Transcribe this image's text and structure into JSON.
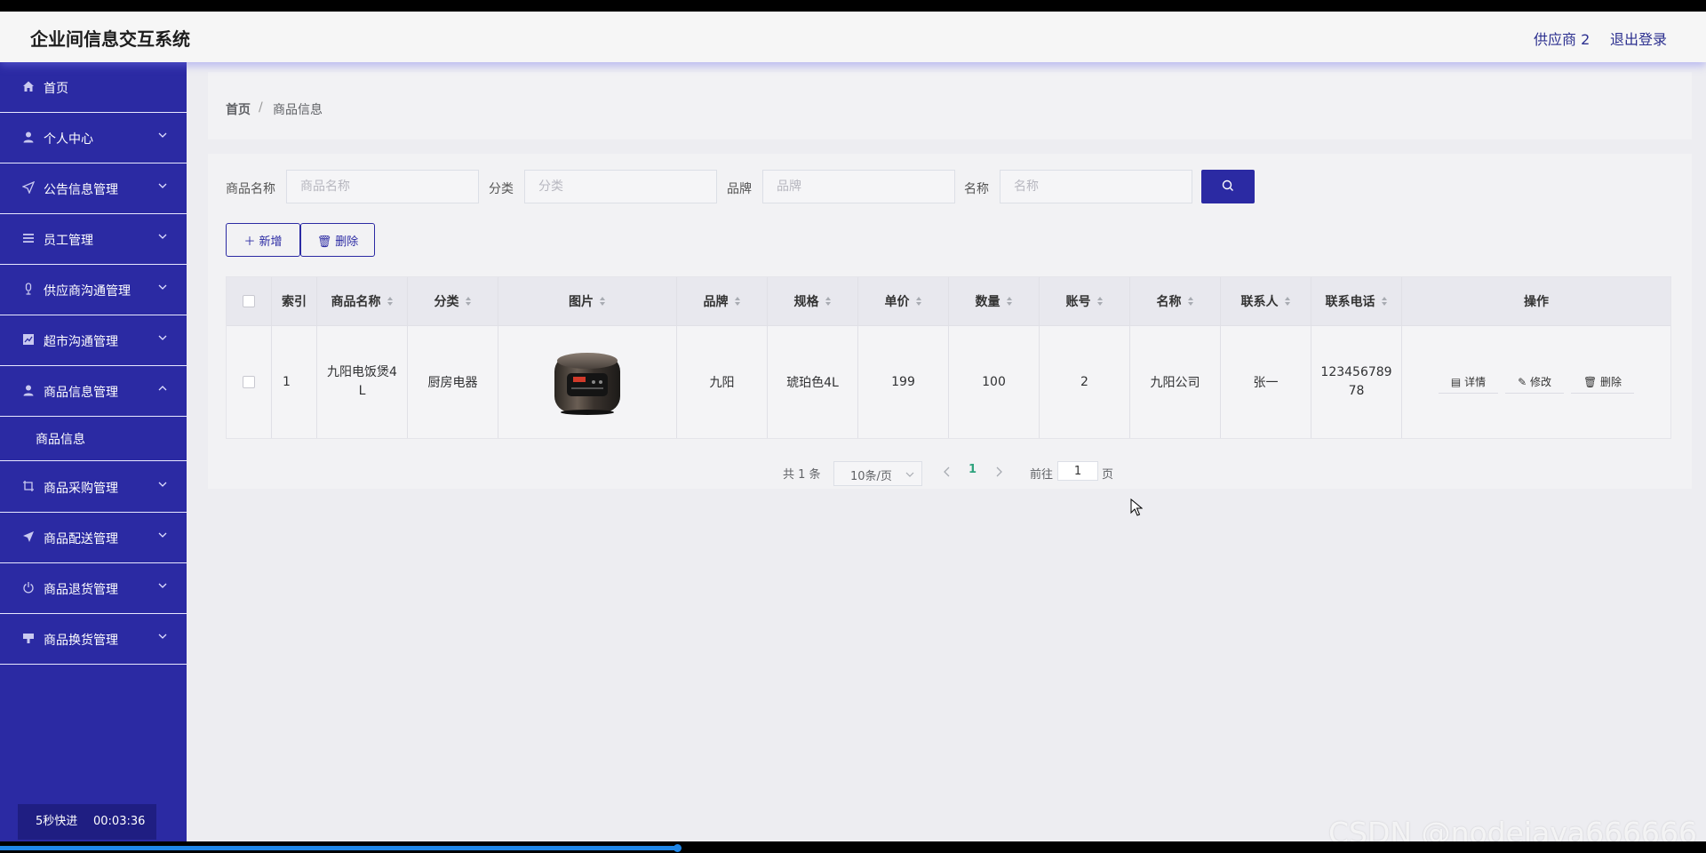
{
  "header": {
    "title": "企业间信息交互系统",
    "user": "供应商 2",
    "logout": "退出登录"
  },
  "sidebar": {
    "items": [
      {
        "label": "首页",
        "icon": "home-icon",
        "has_arrow": false
      },
      {
        "label": "个人中心",
        "icon": "user-icon",
        "has_arrow": true
      },
      {
        "label": "公告信息管理",
        "icon": "send-icon",
        "has_arrow": true
      },
      {
        "label": "员工管理",
        "icon": "menu-lines-icon",
        "has_arrow": true
      },
      {
        "label": "供应商沟通管理",
        "icon": "microphone-icon",
        "has_arrow": true
      },
      {
        "label": "超市沟通管理",
        "icon": "chart-icon",
        "has_arrow": true
      },
      {
        "label": "商品信息管理",
        "icon": "user-icon",
        "has_arrow": true,
        "expanded": true
      },
      {
        "label": "商品采购管理",
        "icon": "crop-icon",
        "has_arrow": true
      },
      {
        "label": "商品配送管理",
        "icon": "send-icon",
        "has_arrow": true
      },
      {
        "label": "商品退货管理",
        "icon": "power-icon",
        "has_arrow": true
      },
      {
        "label": "商品换货管理",
        "icon": "stamp-icon",
        "has_arrow": true
      }
    ],
    "sub_item": "商品信息",
    "timer": {
      "speed": "5秒快进",
      "time": "00:03:36"
    }
  },
  "breadcrumb": {
    "home": "首页",
    "separator": "/",
    "current": "商品信息"
  },
  "filters": [
    {
      "label": "商品名称",
      "placeholder": "商品名称"
    },
    {
      "label": "分类",
      "placeholder": "分类"
    },
    {
      "label": "品牌",
      "placeholder": "品牌"
    },
    {
      "label": "名称",
      "placeholder": "名称"
    }
  ],
  "actions": {
    "add": "新增",
    "delete": "删除"
  },
  "table": {
    "headers": [
      "索引",
      "商品名称",
      "分类",
      "图片",
      "品牌",
      "规格",
      "单价",
      "数量",
      "账号",
      "名称",
      "联系人",
      "联系电话",
      "操作"
    ],
    "row": {
      "index": "1",
      "product_name": "九阳电饭煲4L",
      "category": "厨房电器",
      "brand": "九阳",
      "spec": "琥珀色4L",
      "price": "199",
      "quantity": "100",
      "account": "2",
      "company": "九阳公司",
      "contact": "张一",
      "phone": "12345678978"
    },
    "row_actions": {
      "detail": "详情",
      "edit": "修改",
      "delete": "删除"
    }
  },
  "pagination": {
    "total": "共 1 条",
    "page_size": "10条/页",
    "current": "1",
    "goto_prefix": "前往",
    "goto_value": "1",
    "goto_suffix": "页"
  },
  "watermark": "CSDN @nodejava666666",
  "video": {
    "progress": 0.397
  },
  "colors": {
    "sidebar": "#2b2aa3",
    "accent": "#2b2aa3",
    "page_active": "#2fa37e"
  }
}
